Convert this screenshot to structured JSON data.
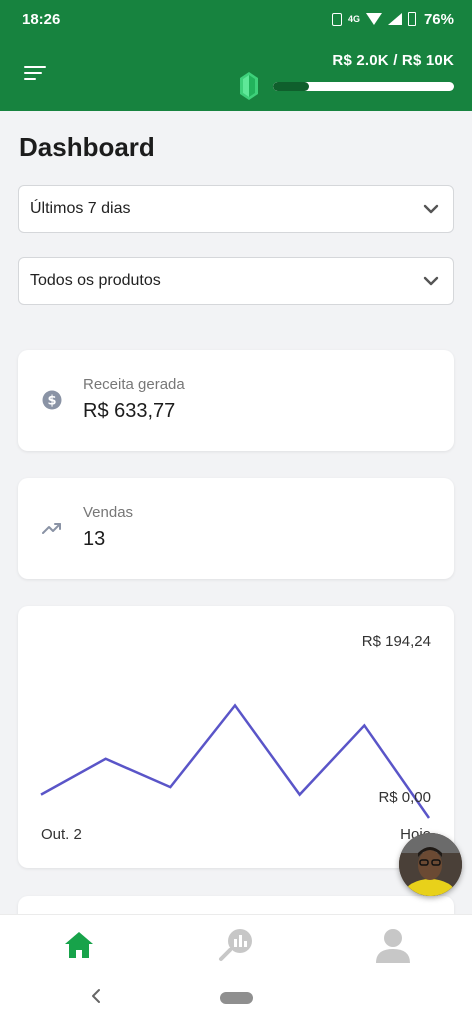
{
  "status_bar": {
    "time": "18:26",
    "network": "4G",
    "battery": "76%"
  },
  "header": {
    "goal_text": "R$ 2.0K / R$ 10K",
    "goal_progress": 0.2,
    "accent_color": "#17833f",
    "icons": [
      "menu-icon",
      "gem-icon"
    ]
  },
  "page": {
    "title": "Dashboard"
  },
  "filters": {
    "period_selected": "Últimos 7 dias",
    "product_selected": "Todos os produtos"
  },
  "stats": {
    "revenue_label": "Receita gerada",
    "revenue_value": "R$ 633,77",
    "revenue_icon": "dollar-circle-icon",
    "sales_label": "Vendas",
    "sales_value": "13",
    "sales_icon": "trending-up-icon"
  },
  "chart": {
    "max_label": "R$ 194,24",
    "min_label": "R$ 0,00",
    "x_start_label": "Out. 2",
    "x_end_label": "Hoje"
  },
  "chart_data": {
    "type": "line",
    "x": [
      "Out. 2",
      "",
      "",
      "",
      "",
      "",
      "Hoje"
    ],
    "values": [
      28,
      71,
      37,
      135,
      28,
      111,
      0
    ],
    "ylim": [
      0,
      194.24
    ],
    "line_color": "#5a55c8",
    "grid": false
  },
  "bottom_nav": {
    "items": [
      "home-icon",
      "analytics-icon",
      "profile-icon"
    ],
    "active_color": "#17a34a"
  }
}
